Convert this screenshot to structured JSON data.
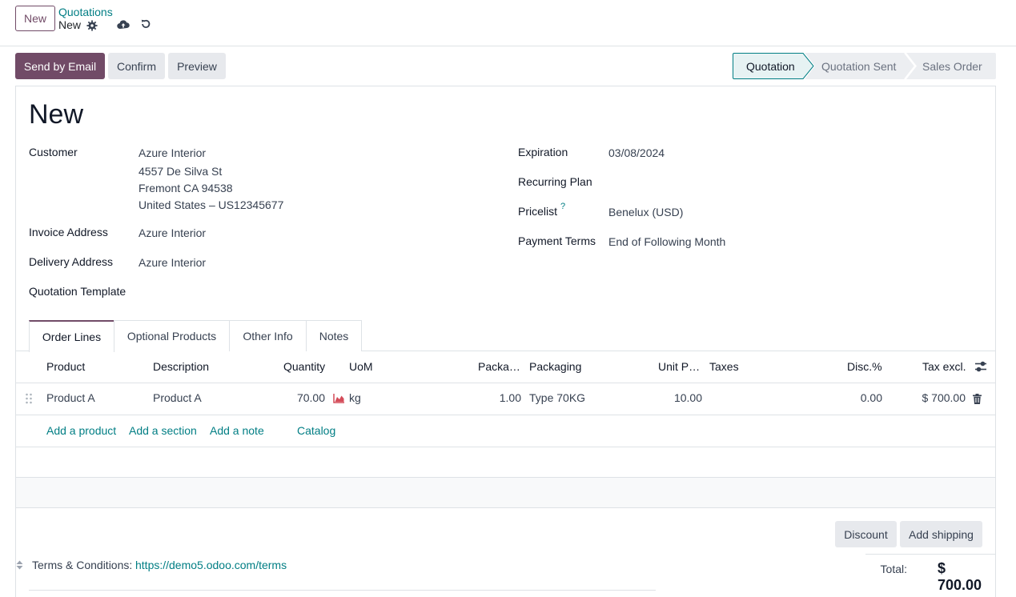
{
  "control_panel": {
    "new_label": "New",
    "breadcrumb_parent": "Quotations",
    "breadcrumb_current": "New"
  },
  "statusbar": {
    "send_email_label": "Send by Email",
    "confirm_label": "Confirm",
    "preview_label": "Preview",
    "stages": [
      "Quotation",
      "Quotation Sent",
      "Sales Order"
    ]
  },
  "form": {
    "title": "New",
    "customer_label": "Customer",
    "customer_lines": [
      "Azure Interior",
      "4557 De Silva St",
      "Fremont CA 94538",
      "United States – US12345677"
    ],
    "invoice_address_label": "Invoice Address",
    "invoice_address": "Azure Interior",
    "delivery_address_label": "Delivery Address",
    "delivery_address": "Azure Interior",
    "quotation_template_label": "Quotation Template",
    "expiration_label": "Expiration",
    "expiration": "03/08/2024",
    "recurring_plan_label": "Recurring Plan",
    "pricelist_label": "Pricelist",
    "pricelist_help": "?",
    "pricelist": "Benelux (USD)",
    "payment_terms_label": "Payment Terms",
    "payment_terms": "End of Following Month"
  },
  "tabs": [
    "Order Lines",
    "Optional Products",
    "Other Info",
    "Notes"
  ],
  "order_lines": {
    "columns": [
      "Product",
      "Description",
      "Quantity",
      "UoM",
      "Packa…",
      "Packaging",
      "Unit P…",
      "Taxes",
      "Disc.%",
      "Tax excl."
    ],
    "rows": [
      {
        "product": "Product A",
        "description": "Product A",
        "quantity": "70.00",
        "uom": "kg",
        "packaging_qty": "1.00",
        "packaging": "Type 70KG",
        "unit_price": "10.00",
        "taxes": "",
        "discount": "0.00",
        "subtotal": "$ 700.00"
      }
    ],
    "add_product": "Add a product",
    "add_section": "Add a section",
    "add_note": "Add a note",
    "catalog": "Catalog"
  },
  "footer": {
    "discount_label": "Discount",
    "shipping_label": "Add shipping",
    "terms_label": "Terms & Conditions:",
    "terms_link": "https://demo5.odoo.com/terms",
    "total_label": "Total:",
    "total_value": "$ 700.00"
  },
  "colors": {
    "brand": "#714b67",
    "link": "#017e84",
    "forecast_icon": "#d44c59"
  }
}
